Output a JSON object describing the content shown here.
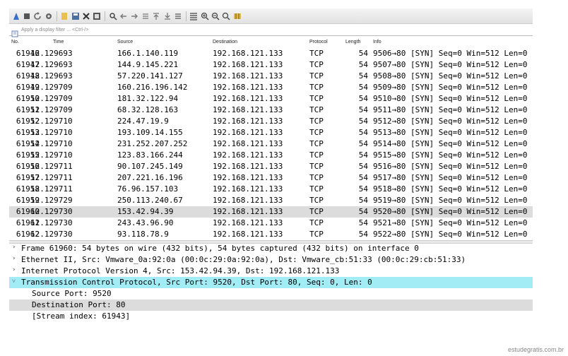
{
  "toolbar": {
    "icons": [
      "shark-fin-start-icon",
      "stop-icon",
      "restart-icon",
      "options-gear-icon",
      "open-file-icon",
      "save-file-icon",
      "close-file-icon",
      "reload-icon",
      "find-icon",
      "go-back-icon",
      "go-forward-icon",
      "go-to-packet-icon",
      "go-first-icon",
      "go-last-icon",
      "autoscroll-icon",
      "colorize-icon",
      "zoom-in-icon",
      "zoom-out-icon",
      "zoom-normal-icon",
      "resize-columns-icon"
    ]
  },
  "filter": {
    "placeholder": "Apply a display filter ... <Ctrl-/>"
  },
  "columns": {
    "no": "No.",
    "time": "Time",
    "source": "Source",
    "destination": "Destination",
    "protocol": "Protocol",
    "length": "Length",
    "info": "Info"
  },
  "packets": [
    {
      "no": "61946",
      "time": "12.129693",
      "src": "166.1.140.119",
      "dst": "192.168.121.133",
      "proto": "TCP",
      "len": "54",
      "info": "9506→80 [SYN] Seq=0 Win=512 Len=0"
    },
    {
      "no": "61947",
      "time": "12.129693",
      "src": "144.9.145.221",
      "dst": "192.168.121.133",
      "proto": "TCP",
      "len": "54",
      "info": "9507→80 [SYN] Seq=0 Win=512 Len=0"
    },
    {
      "no": "61948",
      "time": "12.129693",
      "src": "57.220.141.127",
      "dst": "192.168.121.133",
      "proto": "TCP",
      "len": "54",
      "info": "9508→80 [SYN] Seq=0 Win=512 Len=0"
    },
    {
      "no": "61949",
      "time": "12.129709",
      "src": "160.216.196.142",
      "dst": "192.168.121.133",
      "proto": "TCP",
      "len": "54",
      "info": "9509→80 [SYN] Seq=0 Win=512 Len=0"
    },
    {
      "no": "61950",
      "time": "12.129709",
      "src": "181.32.122.94",
      "dst": "192.168.121.133",
      "proto": "TCP",
      "len": "54",
      "info": "9510→80 [SYN] Seq=0 Win=512 Len=0"
    },
    {
      "no": "61951",
      "time": "12.129709",
      "src": "68.32.128.163",
      "dst": "192.168.121.133",
      "proto": "TCP",
      "len": "54",
      "info": "9511→80 [SYN] Seq=0 Win=512 Len=0"
    },
    {
      "no": "61952",
      "time": "12.129710",
      "src": "224.47.19.9",
      "dst": "192.168.121.133",
      "proto": "TCP",
      "len": "54",
      "info": "9512→80 [SYN] Seq=0 Win=512 Len=0"
    },
    {
      "no": "61953",
      "time": "12.129710",
      "src": "193.109.14.155",
      "dst": "192.168.121.133",
      "proto": "TCP",
      "len": "54",
      "info": "9513→80 [SYN] Seq=0 Win=512 Len=0"
    },
    {
      "no": "61954",
      "time": "12.129710",
      "src": "231.252.207.252",
      "dst": "192.168.121.133",
      "proto": "TCP",
      "len": "54",
      "info": "9514→80 [SYN] Seq=0 Win=512 Len=0"
    },
    {
      "no": "61955",
      "time": "12.129710",
      "src": "123.83.166.244",
      "dst": "192.168.121.133",
      "proto": "TCP",
      "len": "54",
      "info": "9515→80 [SYN] Seq=0 Win=512 Len=0"
    },
    {
      "no": "61956",
      "time": "12.129711",
      "src": "90.107.245.149",
      "dst": "192.168.121.133",
      "proto": "TCP",
      "len": "54",
      "info": "9516→80 [SYN] Seq=0 Win=512 Len=0"
    },
    {
      "no": "61957",
      "time": "12.129711",
      "src": "207.221.16.196",
      "dst": "192.168.121.133",
      "proto": "TCP",
      "len": "54",
      "info": "9517→80 [SYN] Seq=0 Win=512 Len=0"
    },
    {
      "no": "61958",
      "time": "12.129711",
      "src": "76.96.157.103",
      "dst": "192.168.121.133",
      "proto": "TCP",
      "len": "54",
      "info": "9518→80 [SYN] Seq=0 Win=512 Len=0"
    },
    {
      "no": "61959",
      "time": "12.129729",
      "src": "250.113.240.67",
      "dst": "192.168.121.133",
      "proto": "TCP",
      "len": "54",
      "info": "9519→80 [SYN] Seq=0 Win=512 Len=0"
    },
    {
      "no": "61960",
      "time": "12.129730",
      "src": "153.42.94.39",
      "dst": "192.168.121.133",
      "proto": "TCP",
      "len": "54",
      "info": "9520→80 [SYN] Seq=0 Win=512 Len=0",
      "selected": true
    },
    {
      "no": "61961",
      "time": "12.129730",
      "src": "243.43.96.90",
      "dst": "192.168.121.133",
      "proto": "TCP",
      "len": "54",
      "info": "9521→80 [SYN] Seq=0 Win=512 Len=0"
    },
    {
      "no": "61962",
      "time": "12.129730",
      "src": "93.118.78.9",
      "dst": "192.168.121.133",
      "proto": "TCP",
      "len": "54",
      "info": "9522→80 [SYN] Seq=0 Win=512 Len=0"
    }
  ],
  "details": [
    {
      "arrow": "›",
      "text": "Frame 61960: 54 bytes on wire (432 bits), 54 bytes captured (432 bits) on interface 0",
      "style": "top"
    },
    {
      "arrow": "›",
      "text": "Ethernet II, Src: Vmware_0a:92:0a (00:0c:29:0a:92:0a), Dst: Vmware_cb:51:33 (00:0c:29:cb:51:33)",
      "style": "top"
    },
    {
      "arrow": "›",
      "text": "Internet Protocol Version 4, Src: 153.42.94.39, Dst: 192.168.121.133",
      "style": "top"
    },
    {
      "arrow": "˅",
      "text": "Transmission Control Protocol, Src Port: 9520, Dst Port: 80, Seq: 0, Len: 0",
      "style": "hl"
    },
    {
      "arrow": "",
      "text": "Source Port: 9520",
      "style": "sub"
    },
    {
      "arrow": "",
      "text": "Destination Port: 80",
      "style": "subsel"
    },
    {
      "arrow": "",
      "text": "[Stream index: 61943]",
      "style": "sub"
    }
  ],
  "watermark": "estudegratis.com.br",
  "colors": {
    "selected_row": "#dcdcdc",
    "highlight_detail": "#a2ecf6"
  }
}
